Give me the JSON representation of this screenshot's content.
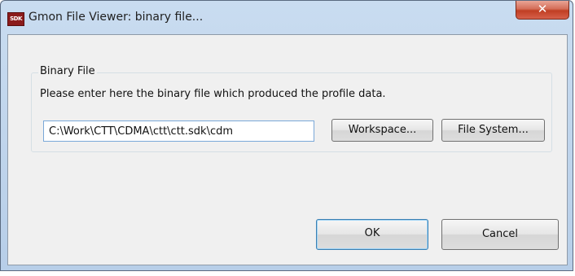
{
  "window": {
    "title": "Gmon File Viewer: binary file...",
    "app_icon_text": "SDK",
    "close_glyph": "✕"
  },
  "group": {
    "legend": "Binary File",
    "description": "Please enter here the binary file which produced the profile data.",
    "binary_path": "C:\\Work\\CTT\\CDMA\\ctt\\ctt.sdk\\cdm",
    "workspace_label": "Workspace...",
    "filesystem_label": "File System..."
  },
  "actions": {
    "ok_label": "OK",
    "cancel_label": "Cancel"
  },
  "colors": {
    "accent": "#3c7fb1",
    "close_red": "#c03e22",
    "app_icon": "#8b1b1b"
  }
}
